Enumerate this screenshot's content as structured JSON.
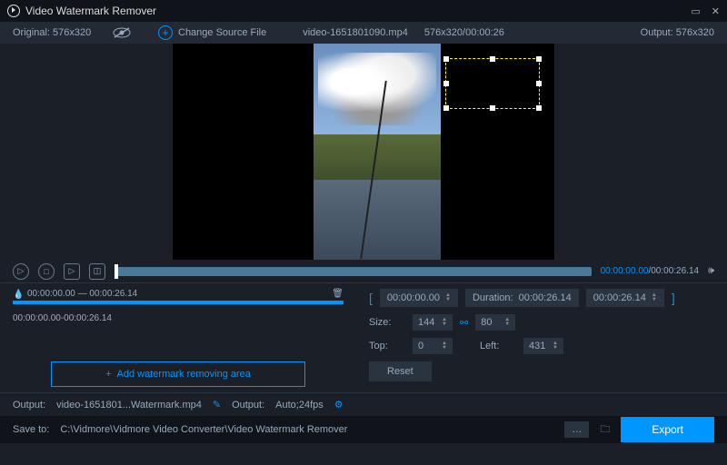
{
  "title": "Video Watermark Remover",
  "topbar": {
    "original_label": "Original:",
    "original_dim": "576x320",
    "change_source": "Change Source File",
    "filename": "video-1651801090.mp4",
    "file_info": "576x320/00:00:26",
    "output_label": "Output:",
    "output_dim": "576x320"
  },
  "playback": {
    "current": "00:00:00.00",
    "total": "00:00:26.14"
  },
  "segment": {
    "range": "00:00:00.00 — 00:00:26.14",
    "time": "00:00:00.00-00:00:26.14"
  },
  "add_button": "Add watermark removing area",
  "controls": {
    "start": "00:00:00.00",
    "duration_label": "Duration:",
    "duration": "00:00:26.14",
    "end": "00:00:26.14",
    "size_label": "Size:",
    "width": "144",
    "height": "80",
    "top_label": "Top:",
    "top": "0",
    "left_label": "Left:",
    "left": "431",
    "reset": "Reset"
  },
  "output": {
    "label1": "Output:",
    "filename": "video-1651801...Watermark.mp4",
    "label2": "Output:",
    "format": "Auto;24fps"
  },
  "save": {
    "label": "Save to:",
    "path": "C:\\Vidmore\\Vidmore Video Converter\\Video Watermark Remover",
    "export": "Export"
  }
}
